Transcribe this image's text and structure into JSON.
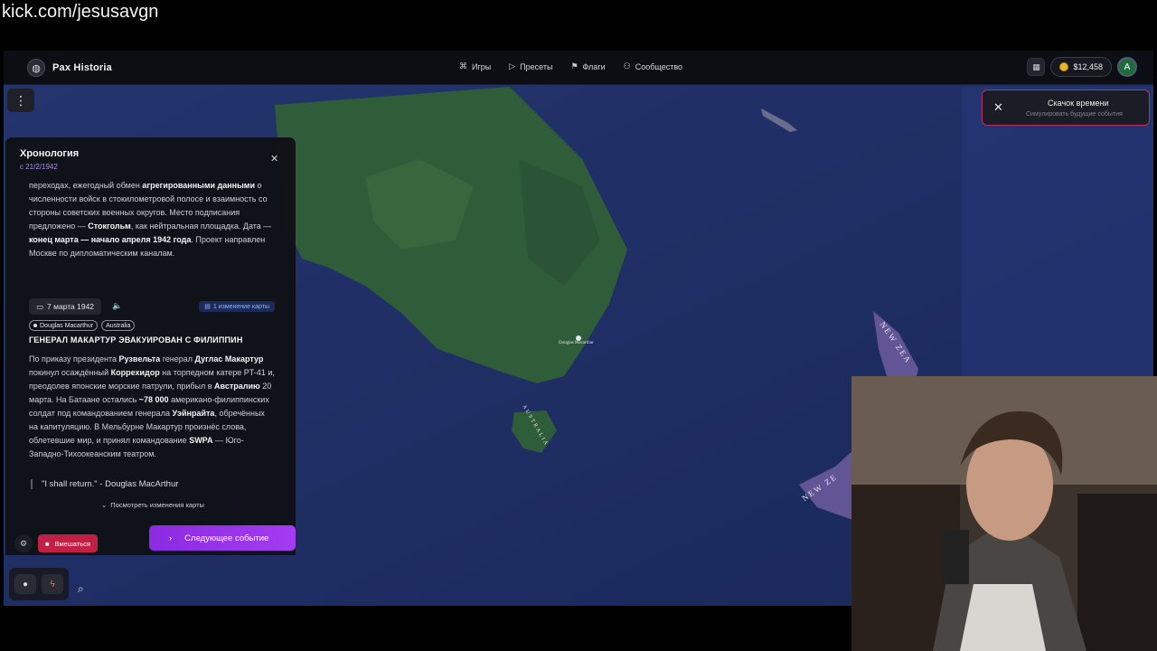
{
  "stream": {
    "url": "kick.com/jesusavgn"
  },
  "app": {
    "name": "Pax Historia"
  },
  "nav": [
    {
      "label": "Игры",
      "icon": "gamepad-icon"
    },
    {
      "label": "Пресеты",
      "icon": "play-icon"
    },
    {
      "label": "Флаги",
      "icon": "flag-icon"
    },
    {
      "label": "Сообщество",
      "icon": "users-icon"
    }
  ],
  "wallet": {
    "balance": "$12,458"
  },
  "user": {
    "initial": "A"
  },
  "time_jump": {
    "title": "Скачок времени",
    "subtitle": "Симулировать будущие события"
  },
  "timeline": {
    "title": "Хронология",
    "since": "с 21/2/1942",
    "prev_event": {
      "p1": "переходах, ежегодный обмен ",
      "b1": "агрегированными данными",
      "p2": " о численности войск в стокилометровой полосе и взаимность со стороны советских военных округов. Место подписания предложено — ",
      "b2": "Стокгольм",
      "p3": ", как нейтральная площадка. Дата — ",
      "b3": "конец марта — начало апреля 1942 года",
      "p4": ". Проект направлен Москве по дипломатическим каналам."
    },
    "event": {
      "date": "7 марта 1942",
      "map_changes": "1 изменение карты",
      "tags": [
        "Douglas Macarthur",
        "Australia"
      ],
      "headline": "ГЕНЕРАЛ МАКАРТУР ЭВАКУИРОВАН С ФИЛИППИН",
      "t1": "По приказу президента ",
      "b1": "Рузвельта",
      "t2": " генерал ",
      "b2": "Дуглас Макартур",
      "t3": " покинул осаждённый ",
      "b3": "Коррехидор",
      "t4": " на торпедном катере PT-41 и, преодолев японские морские патрули, прибыл в ",
      "b4": "Австралию",
      "t5": " 20 марта. На Батаане остались ",
      "b5": "~78 000",
      "t6": " американо-филиппинских солдат под командованием генерала ",
      "b6": "Уэйнрайта",
      "t7": ", обречённых на капитуляцию. В Мельбурне Макартур произнёс слова, облетевшие мир, и принял командование ",
      "b7": "SWPA",
      "t8": " — Юго-Западно-Тихоокеанским театром.",
      "quote": "\"I shall return.\" - Douglas MacArthur",
      "see_changes": "Посмотреть изменения карты"
    },
    "intervene": "Вмешаться",
    "next_event": "Следующее событие"
  },
  "map": {
    "marker_label": "Douglas Macarthur",
    "labels": {
      "australia": "AUSTRALIA",
      "nz_north": "NEW ZEA",
      "nz_south": "NEW ZE"
    }
  }
}
